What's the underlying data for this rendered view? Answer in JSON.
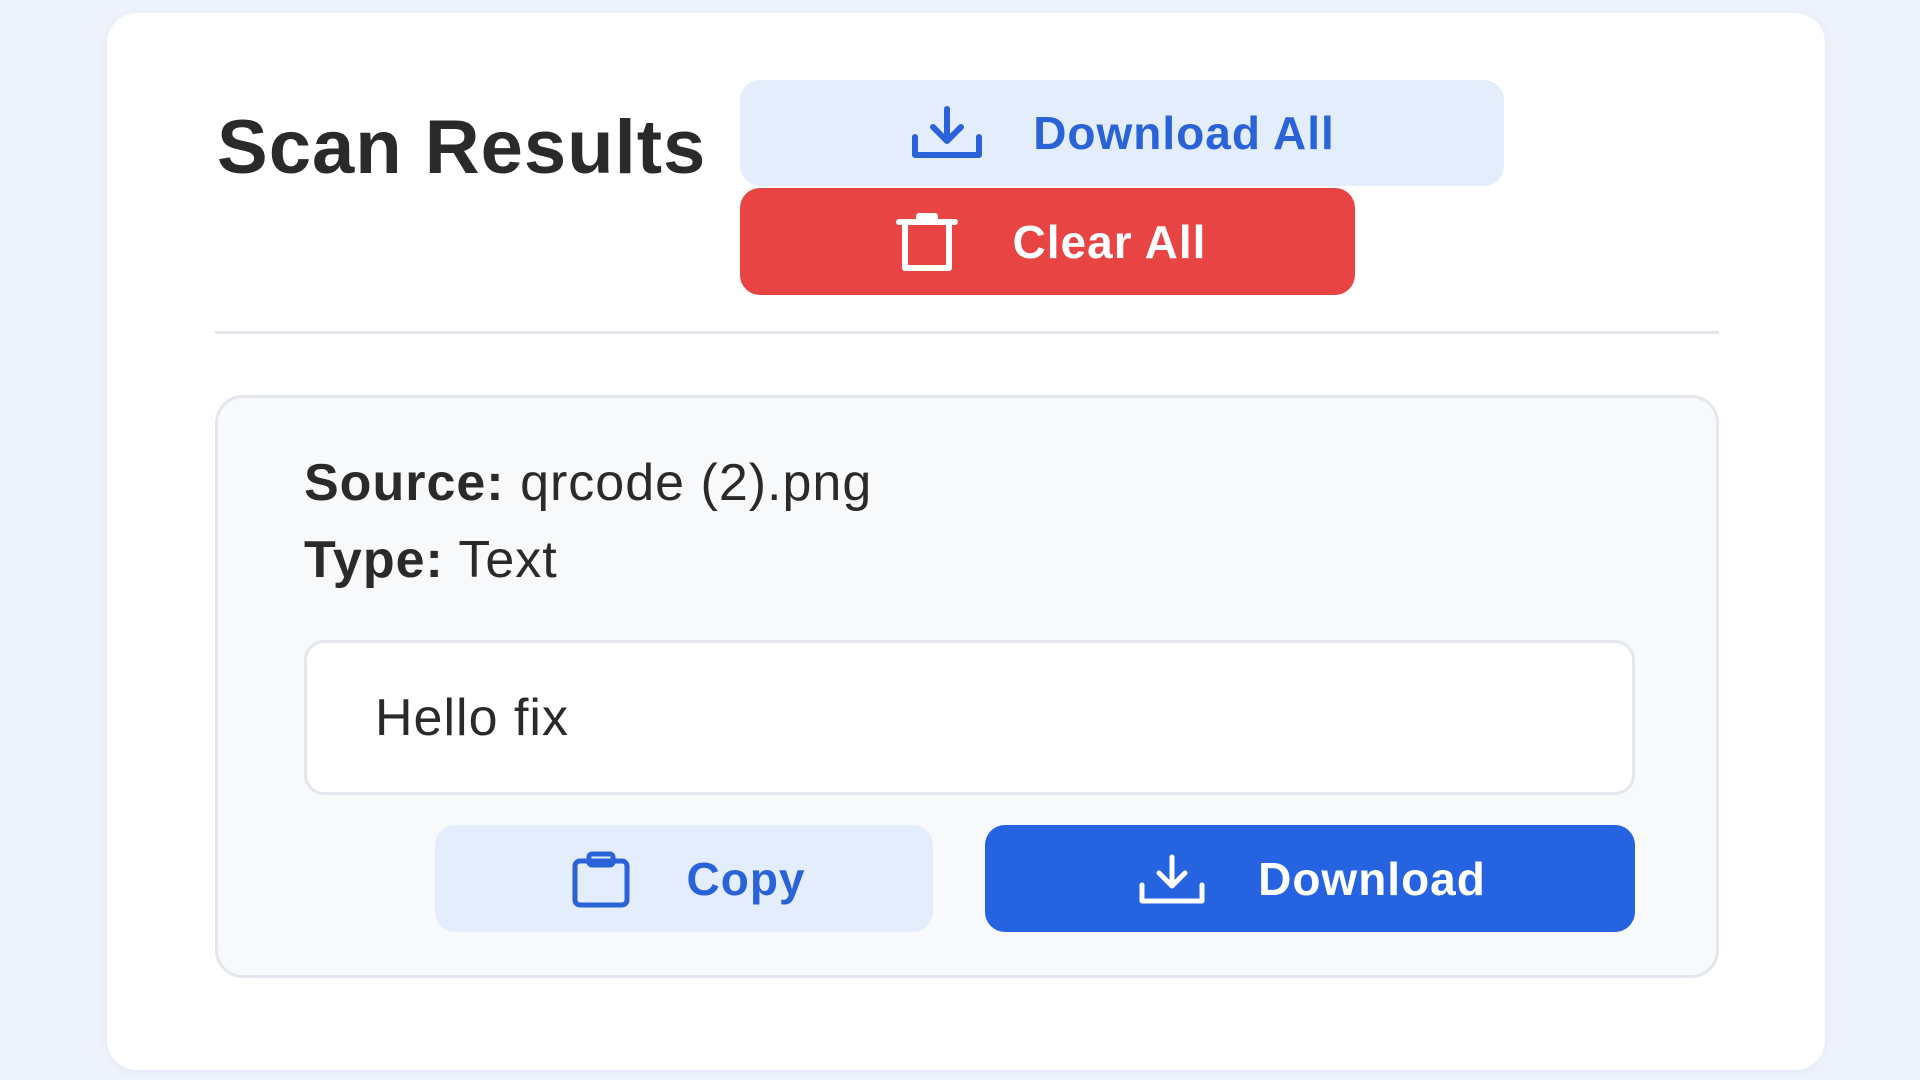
{
  "header": {
    "title": "Scan Results",
    "download_all_label": "Download All",
    "clear_all_label": "Clear All"
  },
  "results": [
    {
      "source_label": "Source:",
      "source_value": "qrcode (2).png",
      "type_label": "Type:",
      "type_value": "Text",
      "content": "Hello fix",
      "copy_label": "Copy",
      "download_label": "Download"
    }
  ],
  "icons": {
    "download_all": "download-icon",
    "clear_all": "trash-icon",
    "copy": "clipboard-icon",
    "download": "download-icon"
  },
  "colors": {
    "page_background": "#eef2fb",
    "primary_blue": "#2563e0",
    "light_blue": "#e3edfb",
    "danger_red": "#e84444",
    "text_dark": "#2a2a2a"
  }
}
